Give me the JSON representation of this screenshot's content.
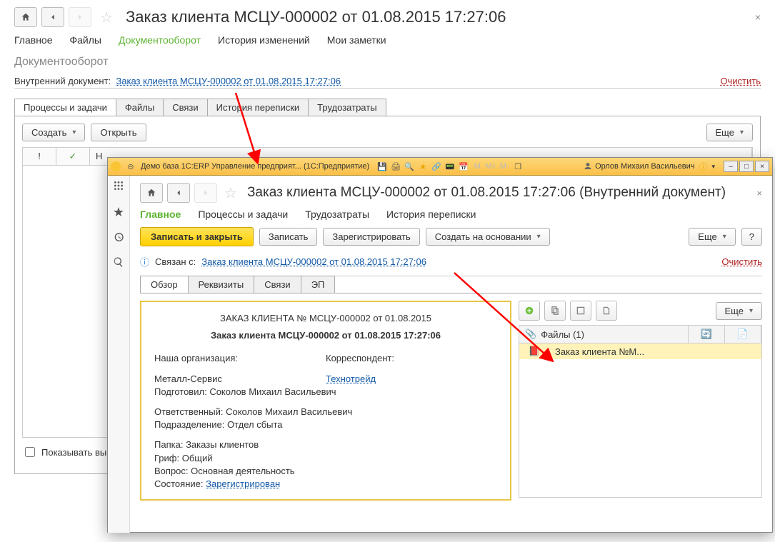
{
  "win1": {
    "title": "Заказ клиента МСЦУ-000002 от 01.08.2015 17:27:06",
    "nav": [
      "Главное",
      "Файлы",
      "Документооборот",
      "История изменений",
      "Мои заметки"
    ],
    "section": "Документооборот",
    "int_label": "Внутренний документ:",
    "int_link": "Заказ клиента МСЦУ-000002 от 01.08.2015 17:27:06",
    "clear": "Очистить",
    "tabs": [
      "Процессы и задачи",
      "Файлы",
      "Связи",
      "История переписки",
      "Трудозатраты"
    ],
    "create_btn": "Создать",
    "open_btn": "Открыть",
    "more_btn": "Еще",
    "grid_cols": {
      "flag": "!",
      "check": "✓",
      "name": "Н"
    },
    "show_done": "Показывать выпо"
  },
  "win2": {
    "wt": "Демо база 1С:ERP Управление предприят... (1С:Предприятие)",
    "user": "Орлов Михаил Васильевич",
    "title": "Заказ клиента МСЦУ-000002 от 01.08.2015 17:27:06 (Внутренний документ)",
    "nav": [
      "Главное",
      "Процессы и задачи",
      "Трудозатраты",
      "История переписки"
    ],
    "btn_save_close": "Записать и закрыть",
    "btn_save": "Записать",
    "btn_register": "Зарегистрировать",
    "btn_create_on": "Создать на основании",
    "more": "Еще",
    "linked_lbl": "Связан с:",
    "linked": "Заказ клиента МСЦУ-000002 от 01.08.2015 17:27:06",
    "clear": "Очистить",
    "tabs": [
      "Обзор",
      "Реквизиты",
      "Связи",
      "ЭП"
    ],
    "doc": {
      "h1": "ЗАКАЗ КЛИЕНТА № МСЦУ-000002 от 01.08.2015",
      "h2": "Заказ клиента МСЦУ-000002 от 01.08.2015 17:27:06",
      "our_org_lbl": "Наша организация:",
      "our_org": "Металл-Сервис",
      "korr_lbl": "Корреспондент:",
      "korr": "Технотрейд",
      "prep_lbl": "Подготовил:",
      "prep": "Соколов Михаил Васильевич",
      "resp_lbl": "Ответственный:",
      "resp": "Соколов Михаил Васильевич",
      "dept_lbl": "Подразделение:",
      "dept": "Отдел сбыта",
      "folder_lbl": "Папка:",
      "folder": "Заказы клиентов",
      "grif_lbl": "Гриф:",
      "grif": "Общий",
      "vopros_lbl": "Вопрос:",
      "vopros": "Основная деятельность",
      "state_lbl": "Состояние:",
      "state": "Зарегистрирован"
    },
    "files": {
      "head": "Файлы (1)",
      "item": "Заказ клиента №М...",
      "more": "Еще"
    }
  }
}
